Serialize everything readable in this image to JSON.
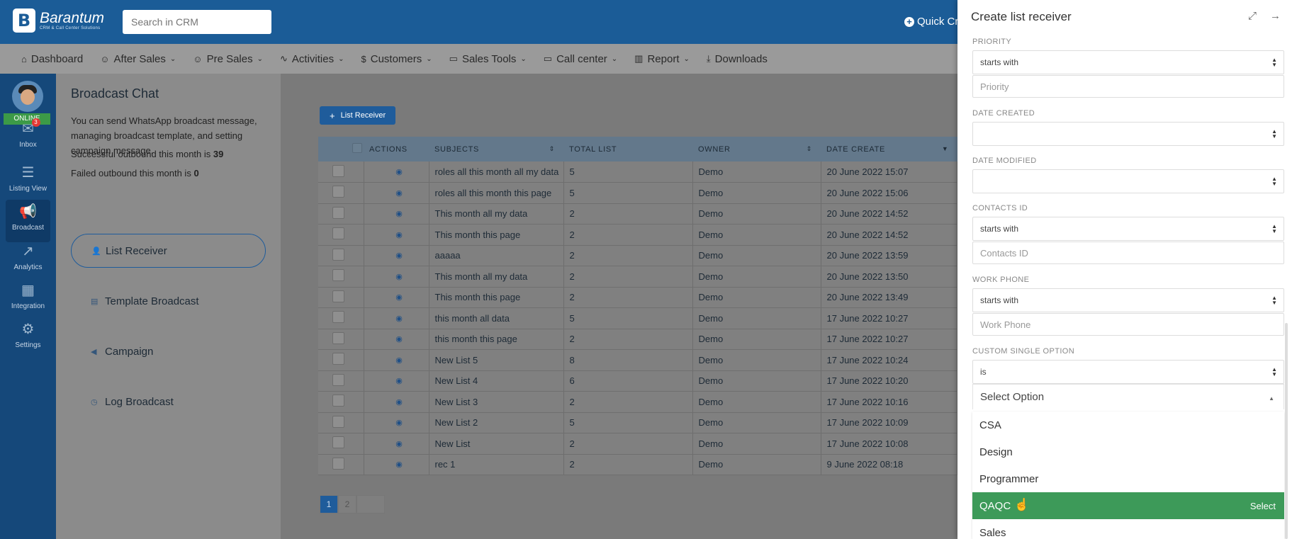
{
  "header": {
    "logo_mark": "B",
    "brand": "Barantum",
    "tagline": "CRM & Call Center Solutions",
    "search_placeholder": "Search in CRM",
    "quick_label": "Quick Cr"
  },
  "nav": [
    {
      "label": "Dashboard",
      "icon": "home-icon",
      "glyph": "⌂",
      "caret": false
    },
    {
      "label": "After Sales",
      "icon": "users-icon",
      "glyph": "☺",
      "caret": true
    },
    {
      "label": "Pre Sales",
      "icon": "users-icon",
      "glyph": "☺",
      "caret": true
    },
    {
      "label": "Activities",
      "icon": "pulse-icon",
      "glyph": "∿",
      "caret": true
    },
    {
      "label": "Customers",
      "icon": "dollar-icon",
      "glyph": "$",
      "caret": true
    },
    {
      "label": "Sales Tools",
      "icon": "folder-icon",
      "glyph": "▭",
      "caret": true
    },
    {
      "label": "Call center",
      "icon": "folder-icon",
      "glyph": "▭",
      "caret": true
    },
    {
      "label": "Report",
      "icon": "bar-chart-icon",
      "glyph": "▥",
      "caret": true
    },
    {
      "label": "Downloads",
      "icon": "download-icon",
      "glyph": "⤓",
      "caret": false
    }
  ],
  "sidebar": {
    "status": "ONLINE",
    "items": [
      {
        "label": "Inbox",
        "icon": "chat-icon",
        "glyph": "✉",
        "badge": "3"
      },
      {
        "label": "Listing View",
        "icon": "list-icon",
        "glyph": "☰",
        "badge": ""
      },
      {
        "label": "Broadcast",
        "icon": "megaphone-icon",
        "glyph": "📢",
        "badge": ""
      },
      {
        "label": "Analytics",
        "icon": "chart-line-icon",
        "glyph": "↗",
        "badge": ""
      },
      {
        "label": "Integration",
        "icon": "grid-icon",
        "glyph": "▦",
        "badge": ""
      },
      {
        "label": "Settings",
        "icon": "gear-icon",
        "glyph": "⚙",
        "badge": ""
      }
    ]
  },
  "panel": {
    "title": "Broadcast Chat",
    "description": "You can send WhatsApp broadcast message, managing broadcast template, and setting campaign message.",
    "success_text": "Successful outbound this month is ",
    "success_count": "39",
    "failed_text": "Failed outbound this month is ",
    "failed_count": "0",
    "menu": [
      {
        "label": "List Receiver",
        "icon": "person-icon",
        "glyph": "👤"
      },
      {
        "label": "Template Broadcast",
        "icon": "calendar-icon",
        "glyph": "▤"
      },
      {
        "label": "Campaign",
        "icon": "megaphone-icon",
        "glyph": "◀"
      },
      {
        "label": "Log Broadcast",
        "icon": "clock-icon",
        "glyph": "◷"
      }
    ]
  },
  "main": {
    "list_button": "List Receiver",
    "columns": [
      "ACTIONS",
      "SUBJECTS",
      "TOTAL LIST",
      "OWNER",
      "DATE CREATE"
    ],
    "rows": [
      {
        "subject": "roles all this month all my data",
        "total": "5",
        "owner": "Demo",
        "date": "20 June 2022 15:07"
      },
      {
        "subject": "roles all this month this page",
        "total": "5",
        "owner": "Demo",
        "date": "20 June 2022 15:06"
      },
      {
        "subject": "This month all my data",
        "total": "2",
        "owner": "Demo",
        "date": "20 June 2022 14:52"
      },
      {
        "subject": "This month this page",
        "total": "2",
        "owner": "Demo",
        "date": "20 June 2022 14:52"
      },
      {
        "subject": "aaaaa",
        "total": "2",
        "owner": "Demo",
        "date": "20 June 2022 13:59"
      },
      {
        "subject": "This month all my data",
        "total": "2",
        "owner": "Demo",
        "date": "20 June 2022 13:50"
      },
      {
        "subject": "This month this page",
        "total": "2",
        "owner": "Demo",
        "date": "20 June 2022 13:49"
      },
      {
        "subject": "this month all data",
        "total": "5",
        "owner": "Demo",
        "date": "17 June 2022 10:27"
      },
      {
        "subject": "this month this page",
        "total": "2",
        "owner": "Demo",
        "date": "17 June 2022 10:27"
      },
      {
        "subject": "New List 5",
        "total": "8",
        "owner": "Demo",
        "date": "17 June 2022 10:24"
      },
      {
        "subject": "New List 4",
        "total": "6",
        "owner": "Demo",
        "date": "17 June 2022 10:20"
      },
      {
        "subject": "New List 3",
        "total": "2",
        "owner": "Demo",
        "date": "17 June 2022 10:16"
      },
      {
        "subject": "New List 2",
        "total": "5",
        "owner": "Demo",
        "date": "17 June 2022 10:09"
      },
      {
        "subject": "New List",
        "total": "2",
        "owner": "Demo",
        "date": "17 June 2022 10:08"
      },
      {
        "subject": "rec 1",
        "total": "2",
        "owner": "Demo",
        "date": "9 June 2022 08:18"
      }
    ],
    "pages": [
      "1",
      "2"
    ]
  },
  "drawer": {
    "title": "Create list receiver",
    "priority_label": "PRIORITY",
    "priority_op": "starts with",
    "priority_placeholder": "Priority",
    "date_created_label": "DATE CREATED",
    "date_modified_label": "DATE MODIFIED",
    "contacts_label": "CONTACTS ID",
    "contacts_op": "starts with",
    "contacts_placeholder": "Contacts ID",
    "work_phone_label": "WORK PHONE",
    "work_phone_op": "starts with",
    "work_phone_placeholder": "Work Phone",
    "custom_label": "CUSTOM SINGLE OPTION",
    "custom_op": "is",
    "custom_placeholder": "Select Option",
    "options": [
      "CSA",
      "Design",
      "Programmer",
      "QAQC",
      "Sales"
    ],
    "highlighted_option": "QAQC",
    "select_hint": "Select"
  }
}
